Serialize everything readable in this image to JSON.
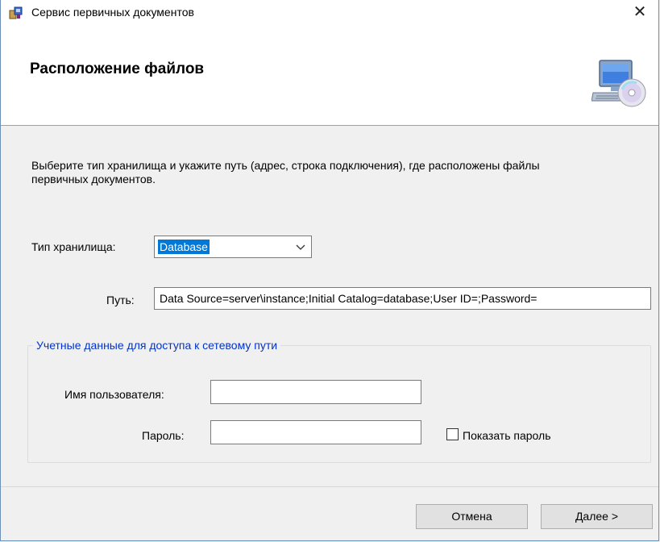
{
  "window": {
    "title": "Сервис первичных документов",
    "close_glyph": "✕"
  },
  "banner": {
    "title": "Расположение файлов",
    "icon": "computer-disc-icon"
  },
  "description": "Выберите тип хранилища и укажите путь (адрес, строка подключения), где расположены файлы первичных документов.",
  "storage": {
    "label": "Тип хранилища:",
    "selected": "Database"
  },
  "path": {
    "label": "Путь:",
    "value": "Data Source=server\\instance;Initial Catalog=database;User ID=;Password="
  },
  "credentials": {
    "legend": "Учетные данные для доступа к сетевому пути",
    "username_label": "Имя пользователя:",
    "username_value": "",
    "password_label": "Пароль:",
    "password_value": "",
    "show_password_label": "Показать пароль",
    "show_password_checked": false
  },
  "buttons": {
    "cancel": "Отмена",
    "next": "Далее >"
  },
  "colors": {
    "selection": "#0078d7",
    "group_legend": "#0033cc",
    "window_border": "#6e8fb8"
  }
}
